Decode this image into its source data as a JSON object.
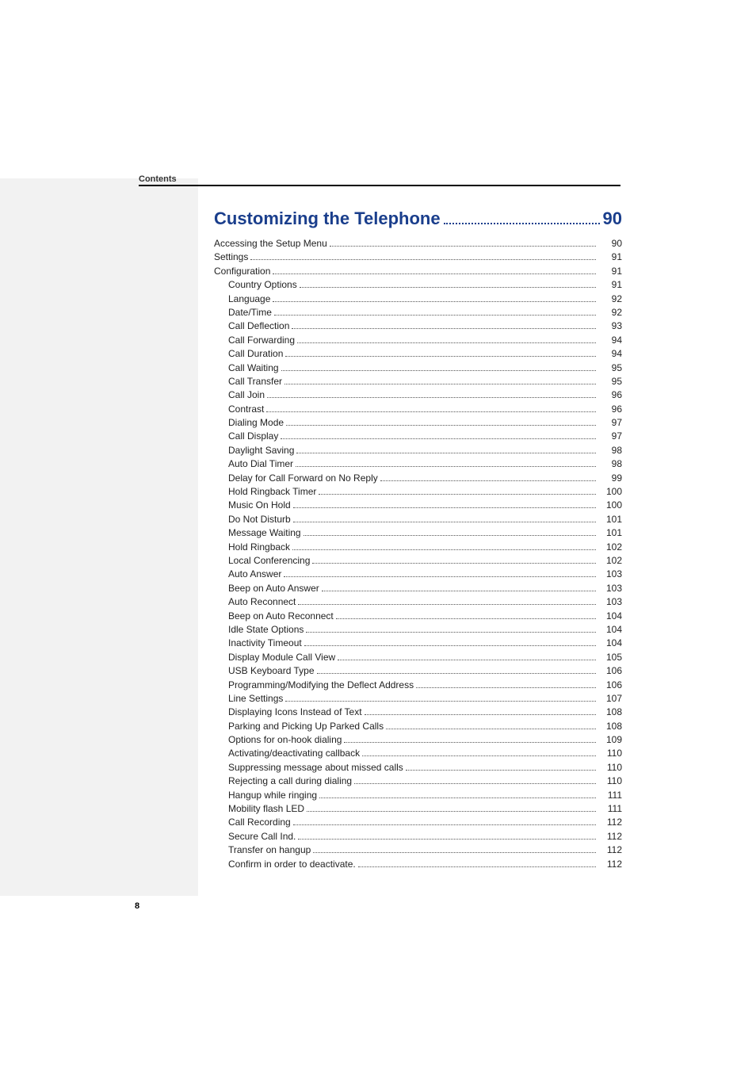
{
  "header": "Contents",
  "pageNumber": "8",
  "section": {
    "title": "Customizing the Telephone",
    "page": "90"
  },
  "entries": [
    {
      "label": "Accessing the Setup Menu",
      "page": "90",
      "indent": 1
    },
    {
      "label": "Settings",
      "page": "91",
      "indent": 1
    },
    {
      "label": "Configuration",
      "page": "91",
      "indent": 1
    },
    {
      "label": "Country Options",
      "page": "91",
      "indent": 2
    },
    {
      "label": "Language",
      "page": "92",
      "indent": 2
    },
    {
      "label": "Date/Time",
      "page": "92",
      "indent": 2
    },
    {
      "label": "Call Deflection",
      "page": "93",
      "indent": 2
    },
    {
      "label": "Call Forwarding",
      "page": "94",
      "indent": 2
    },
    {
      "label": "Call Duration",
      "page": "94",
      "indent": 2
    },
    {
      "label": "Call Waiting",
      "page": "95",
      "indent": 2
    },
    {
      "label": "Call Transfer",
      "page": "95",
      "indent": 2
    },
    {
      "label": "Call Join",
      "page": "96",
      "indent": 2
    },
    {
      "label": "Contrast",
      "page": "96",
      "indent": 2
    },
    {
      "label": "Dialing Mode",
      "page": "97",
      "indent": 2
    },
    {
      "label": "Call Display",
      "page": "97",
      "indent": 2
    },
    {
      "label": "Daylight Saving",
      "page": "98",
      "indent": 2
    },
    {
      "label": "Auto Dial Timer",
      "page": "98",
      "indent": 2
    },
    {
      "label": "Delay for Call Forward on No Reply",
      "page": "99",
      "indent": 2
    },
    {
      "label": "Hold Ringback Timer",
      "page": "100",
      "indent": 2
    },
    {
      "label": "Music On Hold",
      "page": "100",
      "indent": 2
    },
    {
      "label": "Do Not Disturb",
      "page": "101",
      "indent": 2
    },
    {
      "label": "Message Waiting",
      "page": "101",
      "indent": 2
    },
    {
      "label": "Hold Ringback",
      "page": "102",
      "indent": 2
    },
    {
      "label": "Local Conferencing",
      "page": "102",
      "indent": 2
    },
    {
      "label": "Auto Answer",
      "page": "103",
      "indent": 2
    },
    {
      "label": "Beep on Auto Answer",
      "page": "103",
      "indent": 2
    },
    {
      "label": "Auto Reconnect",
      "page": "103",
      "indent": 2
    },
    {
      "label": "Beep on Auto Reconnect",
      "page": "104",
      "indent": 2
    },
    {
      "label": "Idle State Options",
      "page": "104",
      "indent": 2
    },
    {
      "label": "Inactivity Timeout",
      "page": "104",
      "indent": 2
    },
    {
      "label": "Display Module Call View",
      "page": "105",
      "indent": 2
    },
    {
      "label": "USB Keyboard Type",
      "page": "106",
      "indent": 2
    },
    {
      "label": "Programming/Modifying the Deflect Address",
      "page": "106",
      "indent": 2
    },
    {
      "label": "Line Settings",
      "page": "107",
      "indent": 2
    },
    {
      "label": "Displaying Icons Instead of Text",
      "page": "108",
      "indent": 2
    },
    {
      "label": "Parking and Picking Up Parked Calls",
      "page": "108",
      "indent": 2
    },
    {
      "label": "Options for on-hook dialing",
      "page": "109",
      "indent": 2
    },
    {
      "label": "Activating/deactivating callback",
      "page": "110",
      "indent": 2
    },
    {
      "label": "Suppressing message about missed calls",
      "page": "110",
      "indent": 2
    },
    {
      "label": "Rejecting a call during dialing",
      "page": "110",
      "indent": 2
    },
    {
      "label": "Hangup while ringing",
      "page": "111",
      "indent": 2
    },
    {
      "label": "Mobility flash LED",
      "page": "111",
      "indent": 2
    },
    {
      "label": "Call Recording",
      "page": "112",
      "indent": 2
    },
    {
      "label": "Secure Call Ind.",
      "page": "112",
      "indent": 2
    },
    {
      "label": "Transfer on hangup",
      "page": "112",
      "indent": 2
    },
    {
      "label": "Confirm in order to deactivate.",
      "page": "112",
      "indent": 2
    }
  ]
}
